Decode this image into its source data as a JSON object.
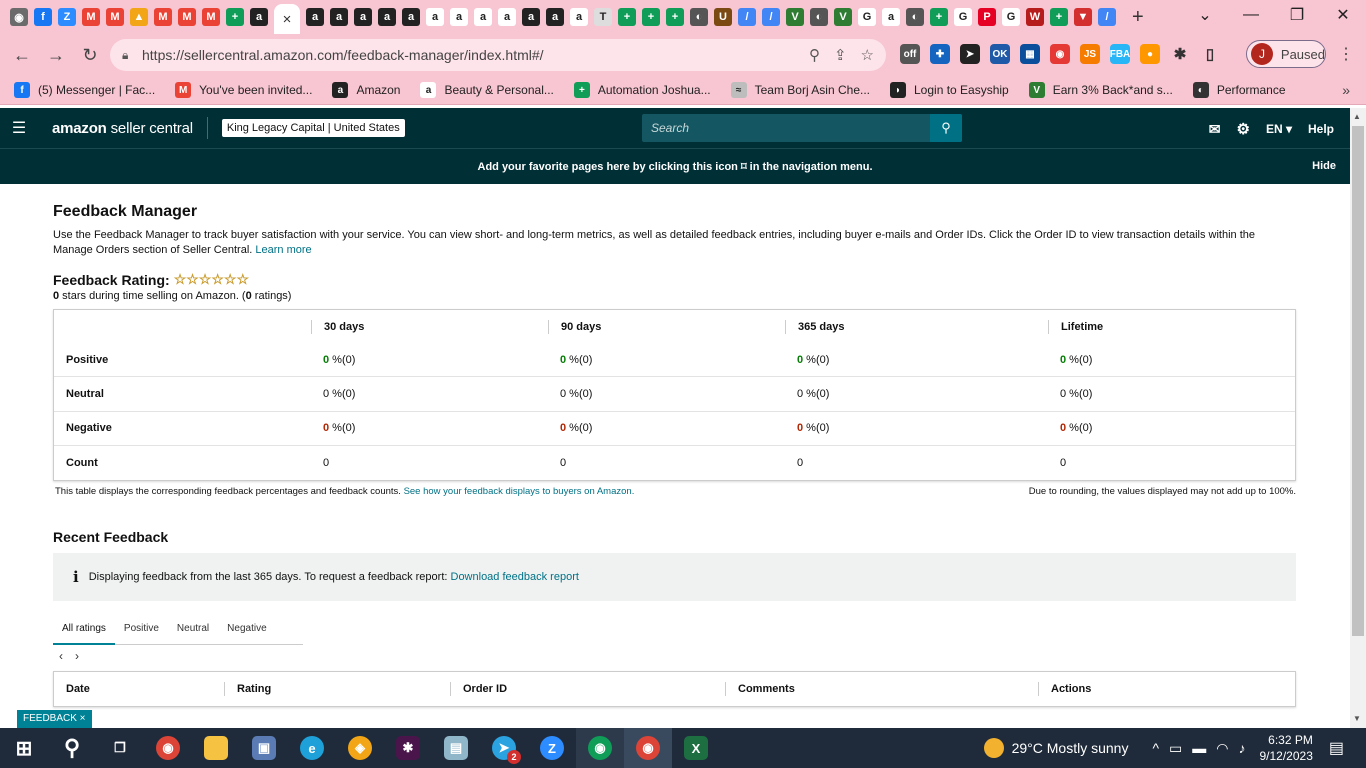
{
  "browser": {
    "active_tab_close": "×",
    "new_tab": "+",
    "url": "https://sellercentral.amazon.com/feedback-manager/index.html#/",
    "profile_initial": "J",
    "profile_status": "Paused",
    "bookmarks": [
      {
        "label": "(5) Messenger | Fac...",
        "color": "#1877f2",
        "glyph": "f"
      },
      {
        "label": "You've been invited...",
        "color": "#ea4335",
        "glyph": "M"
      },
      {
        "label": "Amazon",
        "color": "#222222",
        "glyph": "a"
      },
      {
        "label": "Beauty & Personal...",
        "color": "#ffffff",
        "glyph": "a"
      },
      {
        "label": "Automation Joshua...",
        "color": "#0f9d58",
        "glyph": "+"
      },
      {
        "label": "Team Borj Asin Che...",
        "color": "#bdbdbd",
        "glyph": "≈"
      },
      {
        "label": "Login to Easyship",
        "color": "#222222",
        "glyph": "◗"
      },
      {
        "label": "Earn 3% Back*and s...",
        "color": "#2e7d32",
        "glyph": "V"
      },
      {
        "label": "Performance",
        "color": "#333333",
        "glyph": "◐"
      }
    ]
  },
  "header": {
    "logo_bold": "amazon",
    "logo_thin": " seller central",
    "account": "King Legacy Capital | United States",
    "search_placeholder": "Search",
    "language": "EN",
    "help": "Help",
    "fav_banner": "Add your favorite pages here by clicking this icon ⌑ in the navigation menu.",
    "fav_hide": "Hide"
  },
  "main": {
    "title": "Feedback Manager",
    "description": "Use the Feedback Manager to track buyer satisfaction with your service. You can view short- and long-term metrics, as well as detailed feedback entries, including buyer e-mails and Order IDs. Click the Order ID to view transaction details within the Manage Orders section of Seller Central.",
    "learn_more": "Learn more",
    "rating_label": "Feedback Rating:",
    "stars": "☆☆☆☆☆☆",
    "rating_sub_count": "0",
    "rating_sub_text": " stars during time selling on Amazon. (",
    "rating_sub_ratings": "0",
    "rating_sub_end": " ratings)",
    "table_headers": [
      "30 days",
      "90 days",
      "365 days",
      "Lifetime"
    ],
    "rows": [
      {
        "label": "Positive",
        "kind": "pos",
        "cells": [
          [
            "0",
            " %(0)"
          ],
          [
            "0",
            " %(0)"
          ],
          [
            "0",
            " %(0)"
          ],
          [
            "0",
            " %(0)"
          ]
        ]
      },
      {
        "label": "Neutral",
        "kind": "neu",
        "cells": [
          [
            "0",
            " %(0)"
          ],
          [
            "0",
            " %(0)"
          ],
          [
            "0",
            " %(0)"
          ],
          [
            "0",
            " %(0)"
          ]
        ]
      },
      {
        "label": "Negative",
        "kind": "neg",
        "cells": [
          [
            "0",
            " %(0)"
          ],
          [
            "0",
            " %(0)"
          ],
          [
            "0",
            " %(0)"
          ],
          [
            "0",
            " %(0)"
          ]
        ]
      },
      {
        "label": "Count",
        "kind": "count",
        "cells": [
          [
            "0",
            ""
          ],
          [
            "0",
            ""
          ],
          [
            "0",
            ""
          ],
          [
            "0",
            ""
          ]
        ]
      }
    ],
    "table_note": "This table displays the corresponding feedback percentages and feedback counts.",
    "table_note_link": "See how your feedback displays to buyers on Amazon.",
    "rounding_note": "Due to rounding, the values displayed may not add up to 100%.",
    "recent_title": "Recent Feedback",
    "info_text": "Displaying feedback from the last 365 days. To request a feedback report:",
    "info_link": "Download feedback report",
    "tabs": [
      "All ratings",
      "Positive",
      "Neutral",
      "Negative"
    ],
    "feedback_columns": [
      "Date",
      "Rating",
      "Order ID",
      "Comments",
      "Actions"
    ]
  },
  "feedback_badge": "FEEDBACK ×",
  "taskbar": {
    "temperature": "29°C",
    "weather": "Mostly sunny",
    "time": "6:32 PM",
    "date": "9/12/2023",
    "telegram_badge": "2"
  }
}
